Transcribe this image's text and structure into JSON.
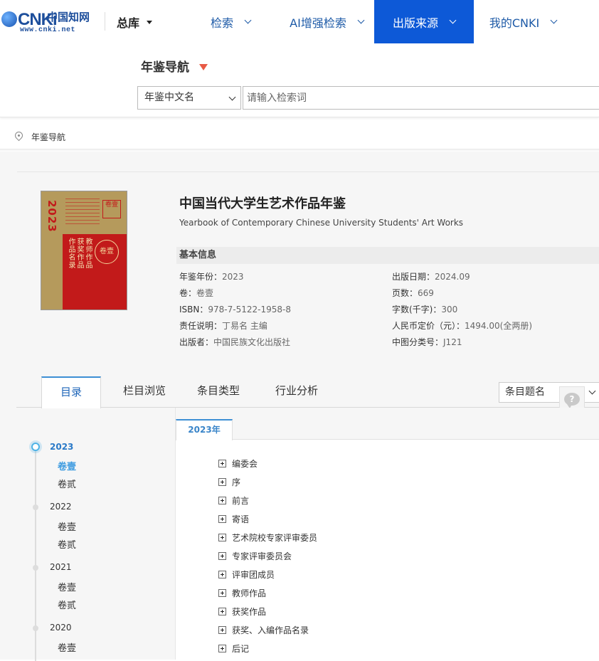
{
  "topnav": {
    "logo_text": "CNKi",
    "logo_cn": "中国知网",
    "logo_url": "www.cnki.net",
    "zongku": "总库",
    "items": [
      {
        "label": "检索"
      },
      {
        "label": "AI增强检索"
      },
      {
        "label": "出版来源"
      },
      {
        "label": "我的CNKI"
      }
    ],
    "active_color": "#0d59d7"
  },
  "search": {
    "title": "年鉴导航",
    "select_value": "年鉴中文名",
    "placeholder": "请输入检索词"
  },
  "breadcrumb": "年鉴导航",
  "book": {
    "title": "中国当代大学生艺术作品年鉴",
    "title_en": "Yearbook of Contemporary Chinese University Students' Art Works",
    "info_heading": "基本信息",
    "cover": {
      "year": "2023",
      "seal": "卷壹",
      "col1": "教师作品",
      "col2": "获奖作品",
      "col3": "作品名录"
    },
    "info_left": [
      {
        "label": "年鉴年份：",
        "value": "2023"
      },
      {
        "label": "卷：",
        "value": "卷壹"
      },
      {
        "label": "ISBN：",
        "value": "978-7-5122-1958-8"
      },
      {
        "label": "责任说明：",
        "value": "丁易名 主编"
      },
      {
        "label": "出版者：",
        "value": "中国民族文化出版社"
      }
    ],
    "info_right": [
      {
        "label": "出版日期：",
        "value": "2024.09"
      },
      {
        "label": "页数：",
        "value": "669"
      },
      {
        "label": "字数(千字)：",
        "value": "300"
      },
      {
        "label": "人民币定价（元）：",
        "value": "1494.00(全两册)"
      },
      {
        "label": "中图分类号：",
        "value": "J121"
      }
    ]
  },
  "tabs": [
    {
      "label": "目录"
    },
    {
      "label": "栏目浏览"
    },
    {
      "label": "条目类型"
    },
    {
      "label": "行业分析"
    }
  ],
  "sort_select": "条目题名",
  "timeline": [
    {
      "year": "2023",
      "vols": [
        "卷壹",
        "卷贰"
      ]
    },
    {
      "year": "2022",
      "vols": [
        "卷壹",
        "卷贰"
      ]
    },
    {
      "year": "2021",
      "vols": [
        "卷壹",
        "卷贰"
      ]
    },
    {
      "year": "2020",
      "vols": [
        "卷壹"
      ]
    }
  ],
  "panel": {
    "year_tab": "2023年",
    "toc": [
      "编委会",
      "序",
      "前言",
      "寄语",
      "艺术院校专家评审委员",
      "专家评审委员会",
      "评审团成员",
      "教师作品",
      "获奖作品",
      "获奖、入编作品名录",
      "后记"
    ]
  }
}
